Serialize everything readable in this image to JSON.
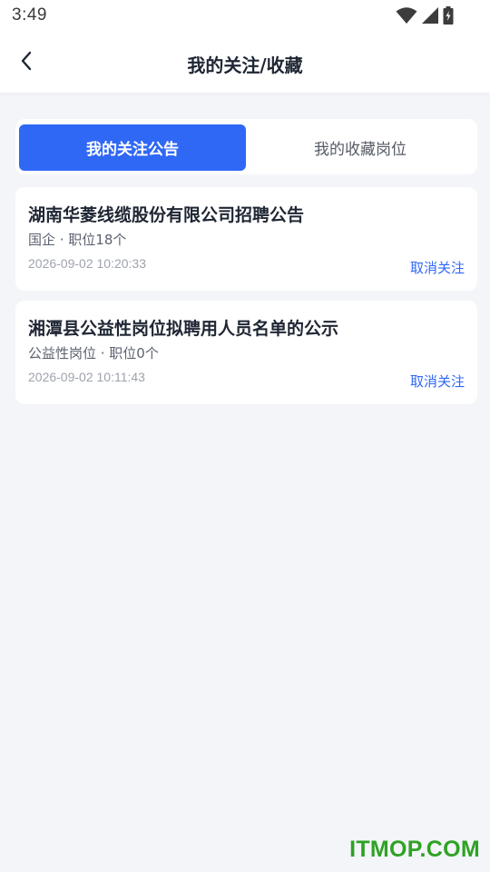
{
  "status_bar": {
    "time": "3:49",
    "icons": [
      "wifi-icon",
      "signal-icon",
      "battery-charging-icon"
    ]
  },
  "header": {
    "back_icon": "chevron-left-icon",
    "title": "我的关注/收藏"
  },
  "tabs": [
    {
      "label": "我的关注公告",
      "active": true
    },
    {
      "label": "我的收藏岗位",
      "active": false
    }
  ],
  "cards": [
    {
      "title": "湖南华菱线缆股份有限公司招聘公告",
      "meta": "国企 · 职位18个",
      "time": "2026-09-02 10:20:33",
      "action": "取消关注"
    },
    {
      "title": "湘潭县公益性岗位拟聘用人员名单的公示",
      "meta": "公益性岗位 · 职位0个",
      "time": "2026-09-02 10:11:43",
      "action": "取消关注"
    }
  ],
  "watermark": "ITMOP.COM",
  "colors": {
    "accent": "#3068f6",
    "background": "#f3f5f9",
    "watermark": "#2fa224"
  }
}
